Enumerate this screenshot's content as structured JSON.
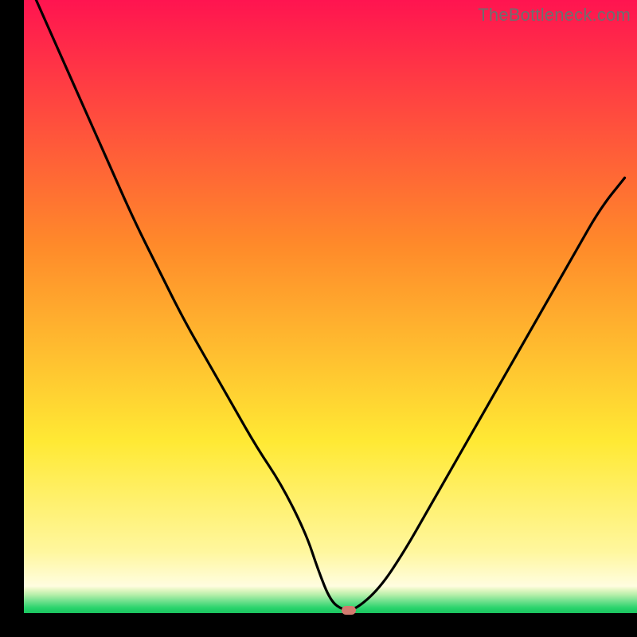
{
  "watermark": "TheBottleneck.com",
  "colors": {
    "red": "#ff1450",
    "orange": "#ff8a2a",
    "yellow": "#ffe934",
    "yellow_pale": "#fff79e",
    "green_strip": "#27d36b",
    "black": "#000000",
    "curve": "#000000",
    "marker": "#d37a6f"
  },
  "chart_data": {
    "type": "line",
    "title": "",
    "xlabel": "",
    "ylabel": "",
    "xlim": [
      0,
      100
    ],
    "ylim": [
      0,
      100
    ],
    "x": [
      2,
      6,
      10,
      14,
      18,
      22,
      26,
      30,
      34,
      38,
      42,
      46,
      48,
      50,
      52,
      54,
      58,
      62,
      66,
      70,
      74,
      78,
      82,
      86,
      90,
      94,
      98
    ],
    "values": [
      100,
      91,
      82,
      73,
      64,
      56,
      48,
      41,
      34,
      27,
      21,
      13,
      7,
      2,
      0.5,
      0.5,
      4,
      10,
      17,
      24,
      31,
      38,
      45,
      52,
      59,
      66,
      71
    ],
    "flat_segment": {
      "x_start": 50,
      "x_end": 54,
      "y": 0.5
    },
    "marker": {
      "x": 53,
      "y": 0.5
    },
    "gradient_stops": [
      {
        "pct": 0,
        "color": "#ff1450"
      },
      {
        "pct": 40,
        "color": "#ff8a2a"
      },
      {
        "pct": 72,
        "color": "#ffe934"
      },
      {
        "pct": 90,
        "color": "#fff79e"
      },
      {
        "pct": 95.6,
        "color": "#fffde0"
      },
      {
        "pct": 96.1,
        "color": "#e9f8c7"
      },
      {
        "pct": 97.0,
        "color": "#b7efaa"
      },
      {
        "pct": 98.0,
        "color": "#73e18f"
      },
      {
        "pct": 99.2,
        "color": "#27d36b"
      },
      {
        "pct": 100,
        "color": "#1bc45f"
      }
    ]
  }
}
